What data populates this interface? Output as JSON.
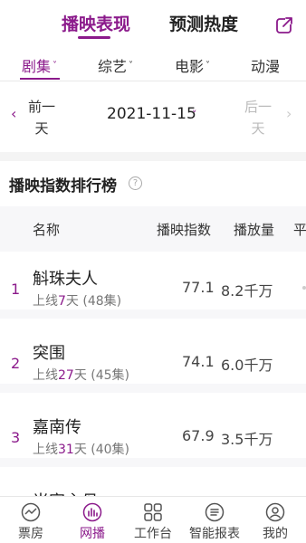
{
  "header": {
    "tabs": [
      {
        "label": "播映表现",
        "active": true
      },
      {
        "label": "预测热度",
        "active": false
      }
    ],
    "share_icon": "share-external-icon"
  },
  "categories": [
    {
      "label": "剧集",
      "active": true,
      "has_dropdown": true
    },
    {
      "label": "综艺",
      "active": false,
      "has_dropdown": true
    },
    {
      "label": "电影",
      "active": false,
      "has_dropdown": true
    },
    {
      "label": "动漫",
      "active": false,
      "has_dropdown": false
    }
  ],
  "date_nav": {
    "prev_label": "前一天",
    "prev_line1": "前一",
    "prev_line2": "天",
    "date": "2021-11-15",
    "next_label": "后一天",
    "next_line1": "后一",
    "next_line2": "天"
  },
  "section": {
    "title": "播映指数排行榜",
    "help_glyph": "?"
  },
  "table": {
    "columns": [
      "名称",
      "播映指数",
      "播放量",
      "平"
    ],
    "rows": [
      {
        "rank": "1",
        "title": "斛珠夫人",
        "sub_prefix": "上线",
        "days": "7",
        "sub_suffix": "天 (48集)",
        "index": "77.1",
        "plays": "8.2千万"
      },
      {
        "rank": "2",
        "title": "突围",
        "sub_prefix": "上线",
        "days": "27",
        "sub_suffix": "天 (45集)",
        "index": "74.1",
        "plays": "6.0千万"
      },
      {
        "rank": "3",
        "title": "嘉南传",
        "sub_prefix": "上线",
        "days": "31",
        "sub_suffix": "天 (40集)",
        "index": "67.9",
        "plays": "3.5千万"
      },
      {
        "rank": "",
        "title": "当家主母",
        "sub_prefix": "",
        "days": "",
        "sub_suffix": "",
        "index": "",
        "plays": ""
      }
    ]
  },
  "bottom_nav": [
    {
      "label": "票房",
      "icon": "trend-chart-icon",
      "active": false
    },
    {
      "label": "网播",
      "icon": "bar-chart-icon",
      "active": true
    },
    {
      "label": "工作台",
      "icon": "grid-apps-icon",
      "active": false
    },
    {
      "label": "智能报表",
      "icon": "report-list-icon",
      "active": false
    },
    {
      "label": "我的",
      "icon": "user-profile-icon",
      "active": false
    }
  ],
  "colors": {
    "accent": "#8b1a8b",
    "muted": "#777777",
    "background_alt": "#f7f7f9"
  }
}
